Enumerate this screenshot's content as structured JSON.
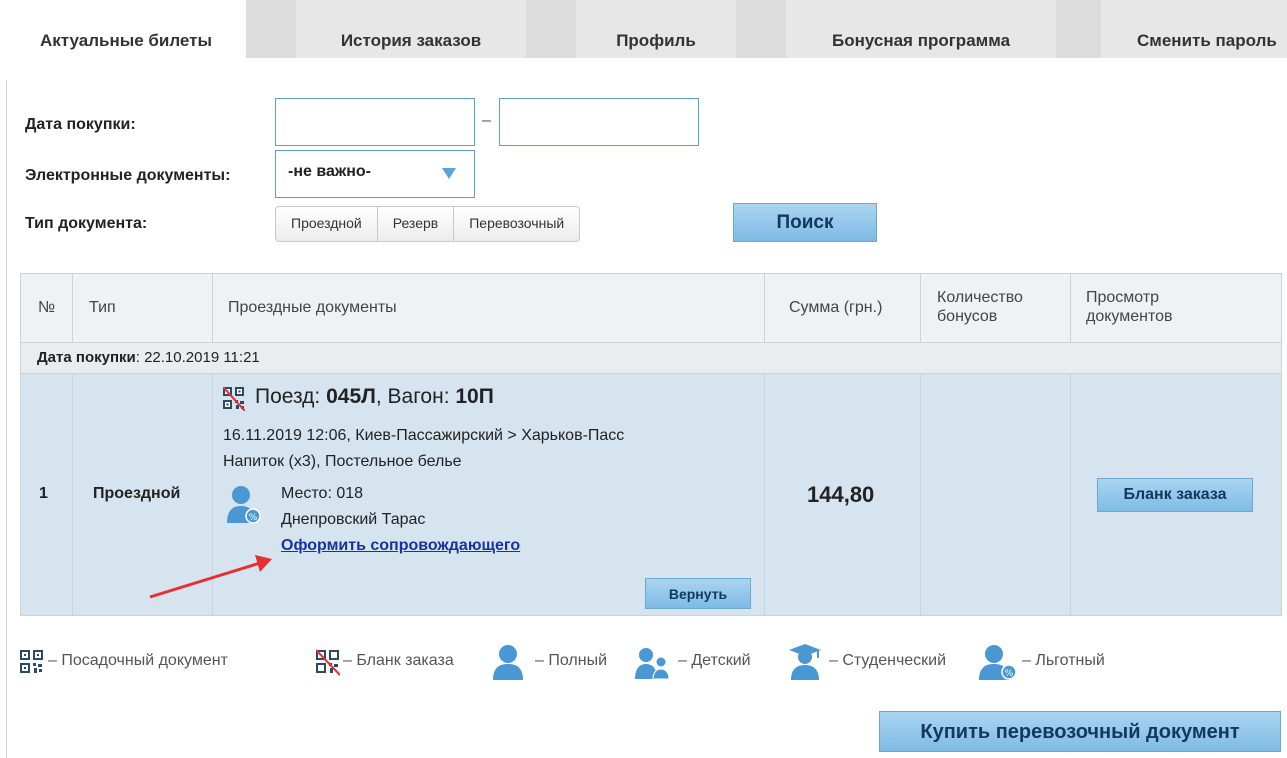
{
  "tabs": [
    {
      "label": "Актуальные билеты"
    },
    {
      "label": "История заказов"
    },
    {
      "label": "Профиль"
    },
    {
      "label": "Бонусная программа"
    },
    {
      "label": "Сменить пароль"
    }
  ],
  "filters": {
    "purchase_date_label": "Дата покупки:",
    "date_separator": "–",
    "edocs_label": "Электронные документы:",
    "edocs_value": "-не важно-",
    "doc_type_label": "Тип документа:",
    "doc_types": [
      "Проездной",
      "Резерв",
      "Перевозочный"
    ],
    "search_button": "Поиск"
  },
  "table": {
    "headers": {
      "num": "№",
      "type": "Тип",
      "docs": "Проездные документы",
      "sum": "Сумма (грн.)",
      "bonuses": "Количество бонусов",
      "view": "Просмотр документов"
    },
    "date_row": {
      "label": "Дата покупки",
      "value": ": 22.10.2019 11:21"
    },
    "row": {
      "num": "1",
      "type": "Проездной",
      "train_prefix": "Поезд: ",
      "train": "045Л",
      "wagon_prefix": ", Вагон: ",
      "wagon": "10П",
      "route": "16.11.2019 12:06, Киев-Пассажирский > Харьков-Пасс",
      "extras": "Напиток (x3), Постельное белье",
      "seat": "Место: 018",
      "passenger": "Днепровский Тарас",
      "companion_link": "Оформить сопровождающего",
      "return_button": "Вернуть",
      "sum": "144,80",
      "bonuses": "",
      "view_button": "Бланк заказа"
    }
  },
  "legend": [
    {
      "icon": "qr-icon",
      "text": "– Посадочный документ"
    },
    {
      "icon": "qr-crossed-icon",
      "text": "– Бланк заказа"
    },
    {
      "icon": "person-full-icon",
      "text": "– Полный"
    },
    {
      "icon": "person-child-icon",
      "text": "– Детский"
    },
    {
      "icon": "person-student-icon",
      "text": "– Студенческий"
    },
    {
      "icon": "person-discount-icon",
      "text": "– Льготный"
    }
  ],
  "buy_button": "Купить перевозочный документ",
  "colors": {
    "accent": "#7fbbe5",
    "row_bg": "#d6e4f0",
    "link": "#1533a6",
    "arrow": "#e53030"
  }
}
